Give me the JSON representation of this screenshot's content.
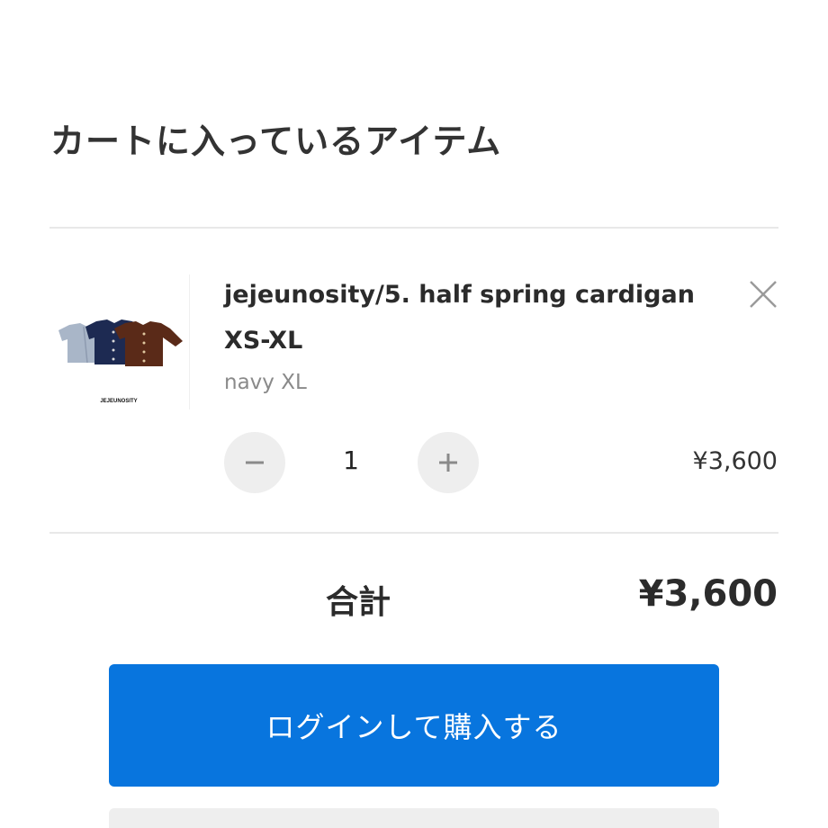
{
  "cart": {
    "title": "カートに入っているアイテム"
  },
  "item": {
    "name": "jejeunosity/5. half spring cardigan XS-XL",
    "variant": "navy XL",
    "quantity": "1",
    "price": "¥3,600",
    "thumbnail": {
      "brand_text": "JEJEUNOSITY",
      "colors": [
        "#a9b6c8",
        "#1d2a52",
        "#5a2a18"
      ]
    },
    "remove_icon": "close-icon",
    "decrement_icon": "minus-icon",
    "increment_icon": "plus-icon"
  },
  "summary": {
    "total_label": "合計",
    "total_price": "¥3,600"
  },
  "actions": {
    "login_purchase_label": "ログインして購入する"
  },
  "colors": {
    "accent": "#0875de",
    "divider": "#e8e8e8",
    "button_gray": "#eeeeee"
  }
}
